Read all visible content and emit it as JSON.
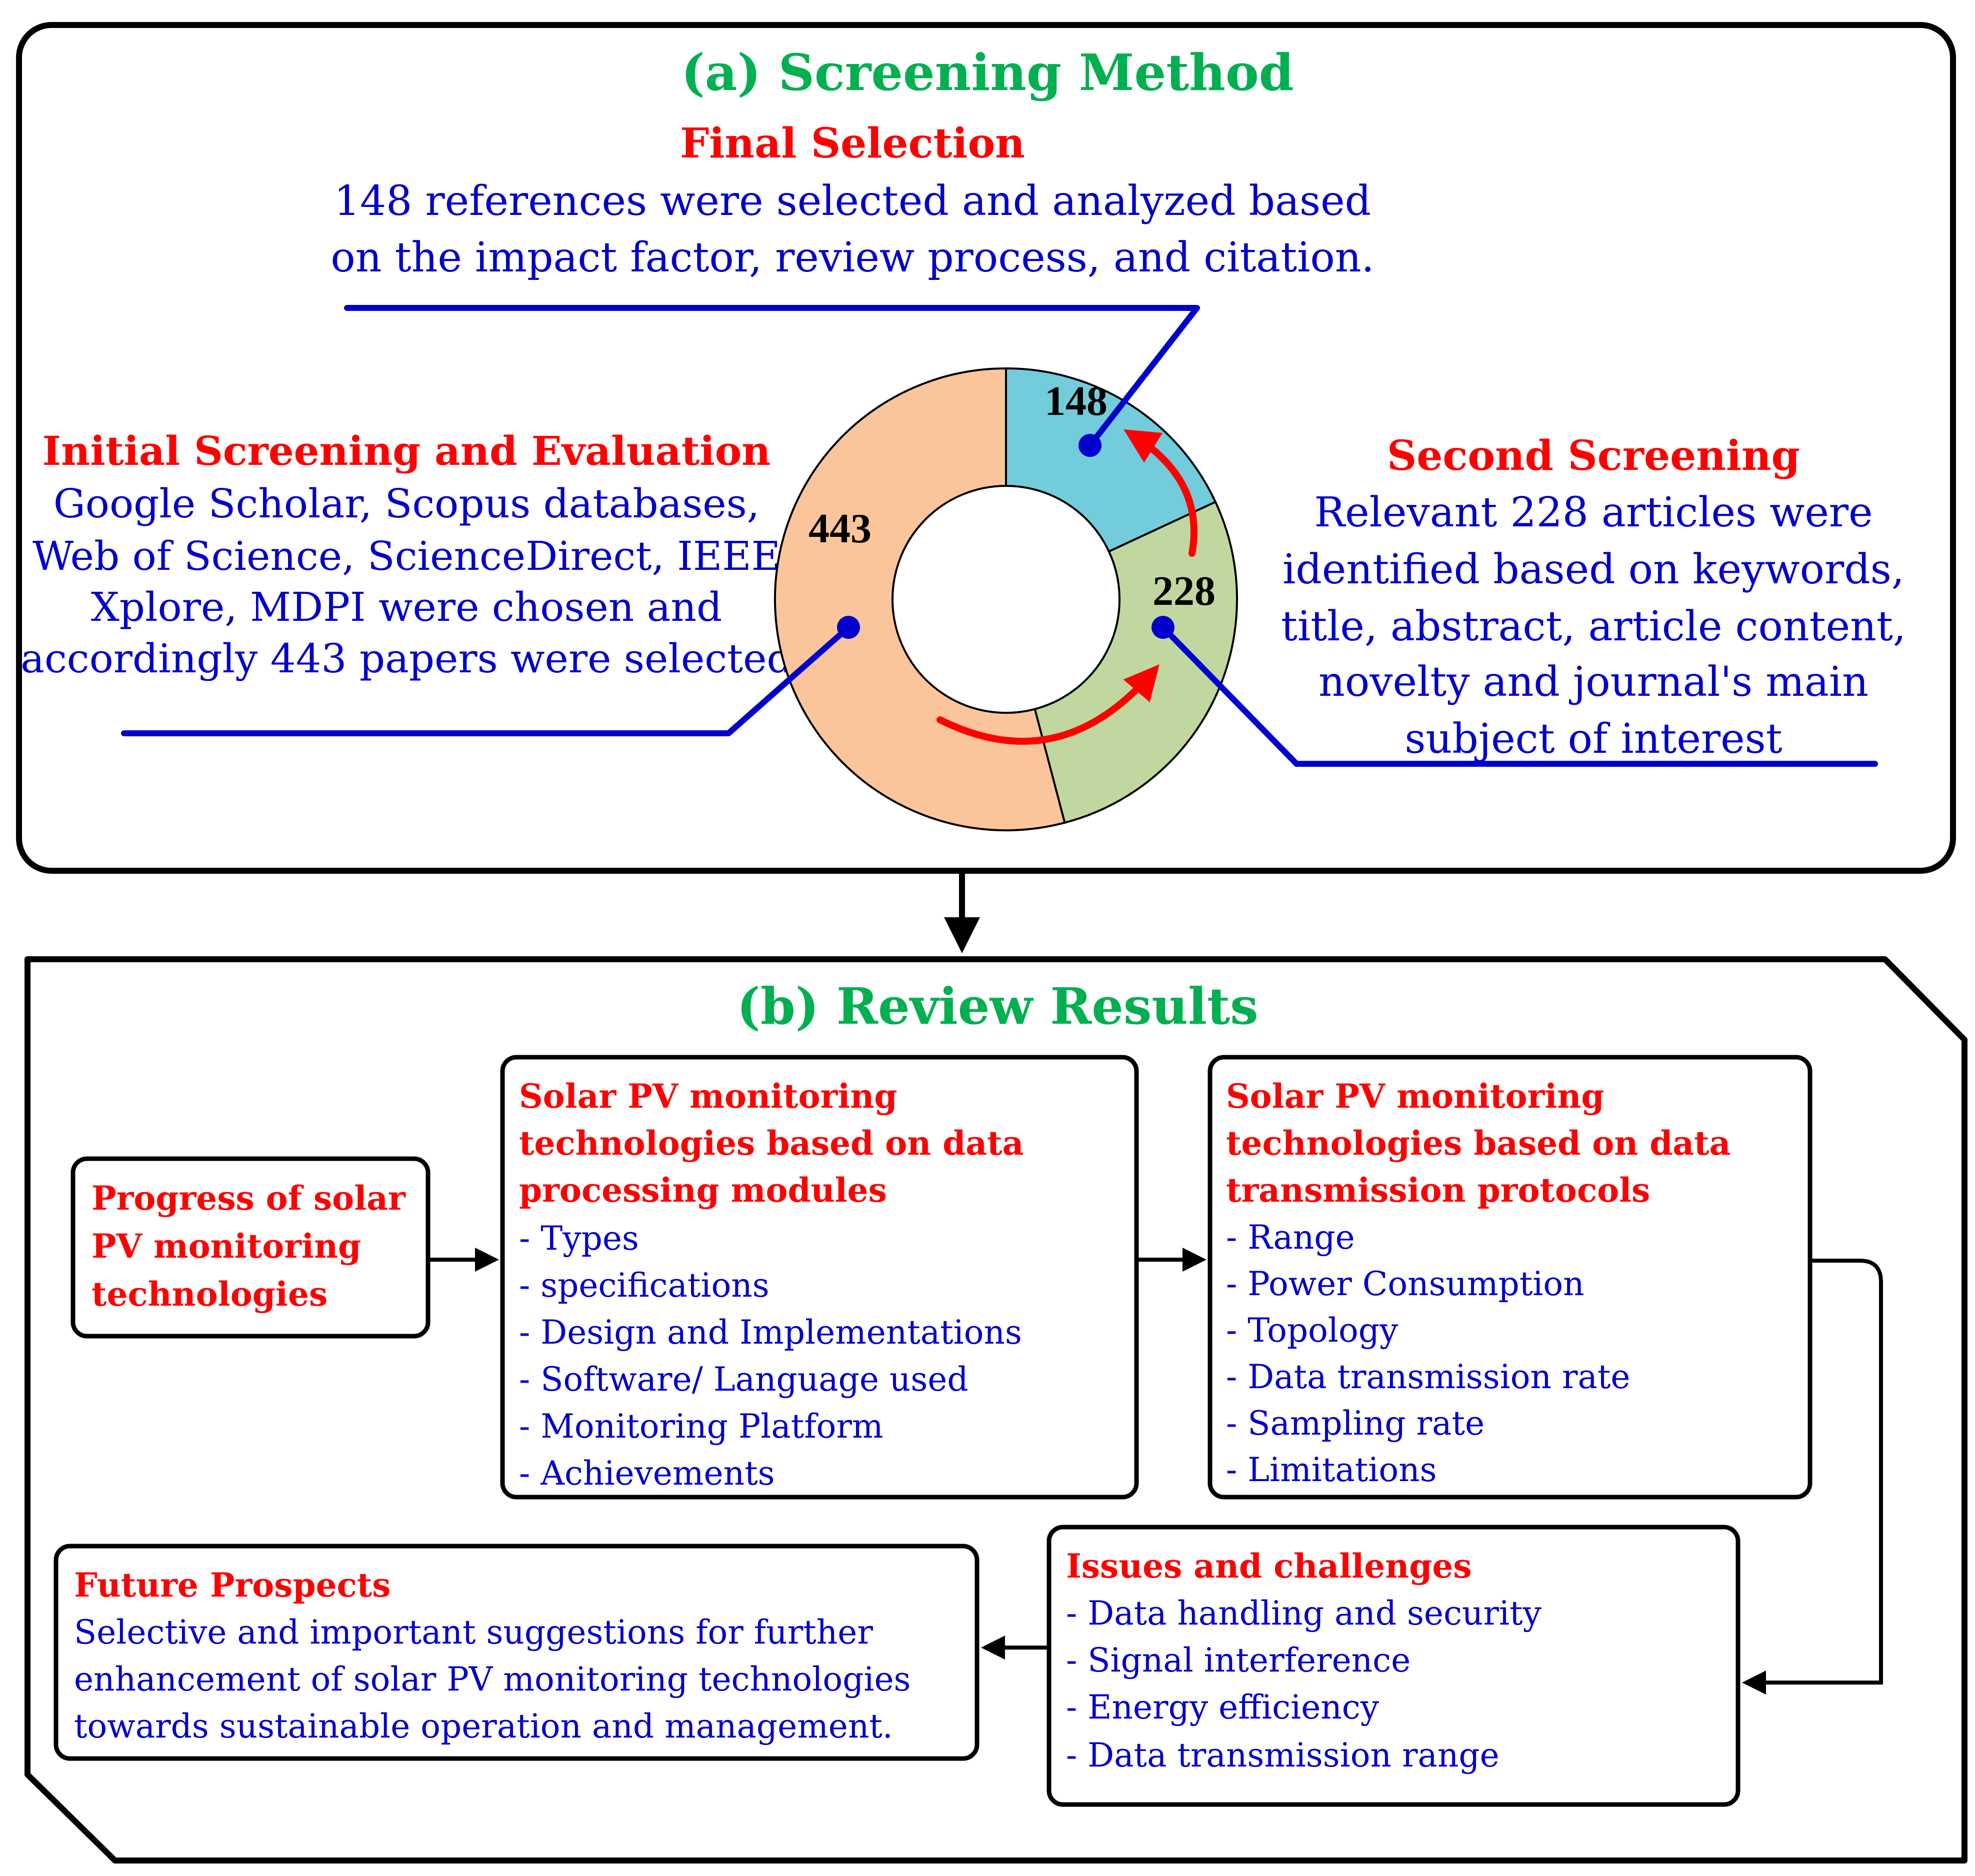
{
  "colors": {
    "title_green": "#00b050",
    "heading_red": "#ff0000",
    "body_blue": "#0000cc",
    "initial_segment": "#fbc59b",
    "second_segment": "#c0d8a0",
    "final_segment": "#72ccdc",
    "flow_arrow_red": "#ff0000",
    "leader_blue": "#0000cc"
  },
  "screening": {
    "title": "(a) Screening Method",
    "final": {
      "heading": "Final Selection",
      "lines": [
        "148 references were selected and analyzed based",
        "on the  impact factor, review process, and citation."
      ]
    },
    "initial": {
      "heading": "Initial Screening and Evaluation",
      "lines": [
        "Google Scholar, Scopus databases,",
        "Web of Science, ScienceDirect, IEEE",
        "Xplore, MDPI were chosen and",
        "accordingly 443 papers were selected"
      ]
    },
    "second": {
      "heading": "Second Screening",
      "lines": [
        "Relevant 228 articles were",
        "identified based on keywords,",
        "title, abstract, article content,",
        "novelty and journal's main",
        "subject of interest"
      ]
    }
  },
  "chart_data": {
    "type": "pie",
    "variant": "donut",
    "title": "",
    "categories": [
      "Final Selection",
      "Second Screening",
      "Initial Screening and Evaluation"
    ],
    "values": [
      148,
      228,
      443
    ],
    "labels": [
      "148",
      "228",
      "443"
    ],
    "start": "top, clockwise",
    "flow": "443 → 228 → 148"
  },
  "review": {
    "title": "(b) Review Results",
    "progress": {
      "heading_lines": [
        "Progress of solar",
        "PV monitoring",
        "technologies"
      ]
    },
    "processing": {
      "heading_lines": [
        "Solar PV monitoring",
        "technologies  based on data",
        "processing modules"
      ],
      "items": [
        "- Types",
        "- specifications",
        "- Design and Implementations",
        "- Software/ Language used",
        "- Monitoring Platform",
        "- Achievements"
      ]
    },
    "transmission": {
      "heading_lines": [
        "Solar PV monitoring",
        "technologies  based on data",
        "transmission protocols"
      ],
      "items": [
        "- Range",
        "- Power Consumption",
        "- Topology",
        "- Data transmission rate",
        "- Sampling rate",
        "- Limitations"
      ]
    },
    "issues": {
      "heading": "Issues and challenges",
      "items": [
        "- Data handling and security",
        "- Signal interference",
        "- Energy efficiency",
        "- Data transmission range"
      ]
    },
    "future": {
      "heading": "Future Prospects",
      "lines": [
        "Selective and important suggestions for further",
        "enhancement of solar PV monitoring technologies",
        "towards sustainable operation and management."
      ]
    }
  }
}
